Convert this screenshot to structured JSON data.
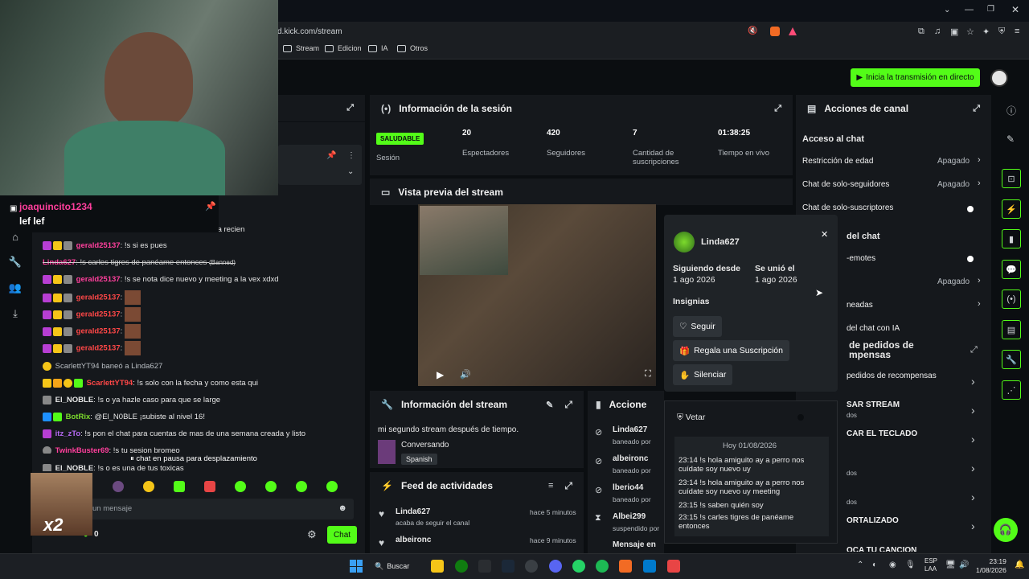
{
  "browser": {
    "url": "d.kick.com/stream",
    "bookmarks": [
      "Stream",
      "Edicion",
      "IA",
      "Otros"
    ]
  },
  "header": {
    "go_live": "Inicia la transmisión en directo"
  },
  "webcam": {
    "streamer_label": "joaquincito1234",
    "overlay_text": "lef lef"
  },
  "chat": {
    "pinned_partial": "ada recien",
    "messages": [
      {
        "user": "gerald25137",
        "text": "!s si es pues"
      },
      {
        "user": "Linda627",
        "text": "!s carles tigres de panéame entonces",
        "tag": "(Banned)"
      },
      {
        "user": "gerald25137",
        "text": "!s se nota dice nuevo y meeting a la vex xdxd"
      },
      {
        "user": "gerald25137",
        "text": ""
      },
      {
        "user": "gerald25137",
        "text": ""
      },
      {
        "user": "gerald25137",
        "text": ""
      },
      {
        "user": "gerald25137",
        "text": ""
      },
      {
        "user": "ScarlettYT94",
        "text": "baneó a Linda627"
      },
      {
        "user": "ScarlettYT94",
        "text": "!s solo con la fecha y como esta qui"
      },
      {
        "user": "El_NOBLE",
        "text": "!s o ya hazle caso para que se large"
      },
      {
        "user": "BotRix",
        "text": "@El_N0BLE ¡subiste al nivel 16!"
      },
      {
        "user": "itz_zTo",
        "text": "!s pon el chat para cuentas de mas de una semana creada y listo"
      },
      {
        "user": "TwinkBuster69",
        "text": "!s tu sesion bromeo"
      },
      {
        "user": "El_NOBLE",
        "text": "!s o es una de tus toxicas"
      }
    ],
    "paused": "chat en pausa para desplazamiento",
    "input_placeholder": "un mensaje",
    "count": "0",
    "send_label": "Chat",
    "overlay_sticker": "x2"
  },
  "session": {
    "title": "Información de la sesión",
    "health": "SALUDABLE",
    "health_label": "Sesión",
    "stats": [
      {
        "value": "20",
        "label": "Espectadores"
      },
      {
        "value": "420",
        "label": "Seguidores"
      },
      {
        "value": "7",
        "label": "Cantidad de suscripciones"
      },
      {
        "value": "01:38:25",
        "label": "Tiempo en vivo"
      }
    ]
  },
  "preview": {
    "title": "Vista previa del stream"
  },
  "stream_info": {
    "title": "Información del stream",
    "stream_title": "mi segundo stream después de tiempo.",
    "category": "Conversando",
    "language": "Spanish"
  },
  "activity": {
    "title": "Feed de actividades",
    "items": [
      {
        "user": "Linda627",
        "desc": "acaba de seguir el canal",
        "time": "hace 5 minutos"
      },
      {
        "user": "albeironc",
        "desc": "",
        "time": "hace 9 minutos"
      }
    ]
  },
  "mod_actions": {
    "title": "Accione",
    "items": [
      {
        "user": "Linda627",
        "desc": "baneado por"
      },
      {
        "user": "albeironc",
        "desc": "baneado por"
      },
      {
        "user": "lberio44",
        "desc": "baneado por"
      },
      {
        "user": "Albei299",
        "desc": "suspendido por"
      },
      {
        "user": "Mensaje en",
        "desc": ""
      }
    ]
  },
  "user_card": {
    "username": "Linda627",
    "following_since_label": "Siguiendo desde",
    "following_since": "1 ago 2026",
    "joined_label": "Se unió el",
    "joined": "1 ago 2026",
    "badges_label": "Insignias",
    "follow": "Seguir",
    "gift": "Regala una Suscripción",
    "mute": "Silenciar",
    "veto": "Vetar",
    "log_date": "Hoy 01/08/2026",
    "log": [
      {
        "time": "23:14",
        "text": "!s hola amiguito ay a perro nos cuídate soy nuevo uy"
      },
      {
        "time": "23:14",
        "text": "!s hola amiguito ay a perro nos cuídate soy nuevo uy meeting"
      },
      {
        "time": "23:15",
        "text": "!s saben quién soy"
      },
      {
        "time": "23:15",
        "text": "!s carles tigres de panéame entonces"
      }
    ]
  },
  "channel_actions": {
    "title": "Acciones de canal",
    "section": "Acceso al chat",
    "rows": [
      {
        "label": "Restricción de edad",
        "value": "Apagado"
      },
      {
        "label": "Chat de solo-seguidores",
        "value": "Apagado"
      },
      {
        "label": "Chat de solo-suscriptores",
        "value": ""
      }
    ],
    "partial_rows": [
      "del chat",
      "-emotes",
      "",
      "neadas",
      "del chat con IA"
    ],
    "partial_values": [
      "Apagado"
    ]
  },
  "rewards": {
    "title": "de pedidos de\nmpensas",
    "rows": [
      "pedidos de recompensas",
      "SAR STREAM",
      "CAR EL TECLADO",
      "",
      "",
      "ORTALIZADO",
      "OCA TU CANCION"
    ],
    "subs": [
      "dos",
      "",
      "",
      "dos",
      "dos"
    ]
  },
  "taskbar": {
    "search": "Buscar",
    "lang": "ESP",
    "lang2": "LAA",
    "time": "23:19",
    "date": "1/08/2026"
  }
}
